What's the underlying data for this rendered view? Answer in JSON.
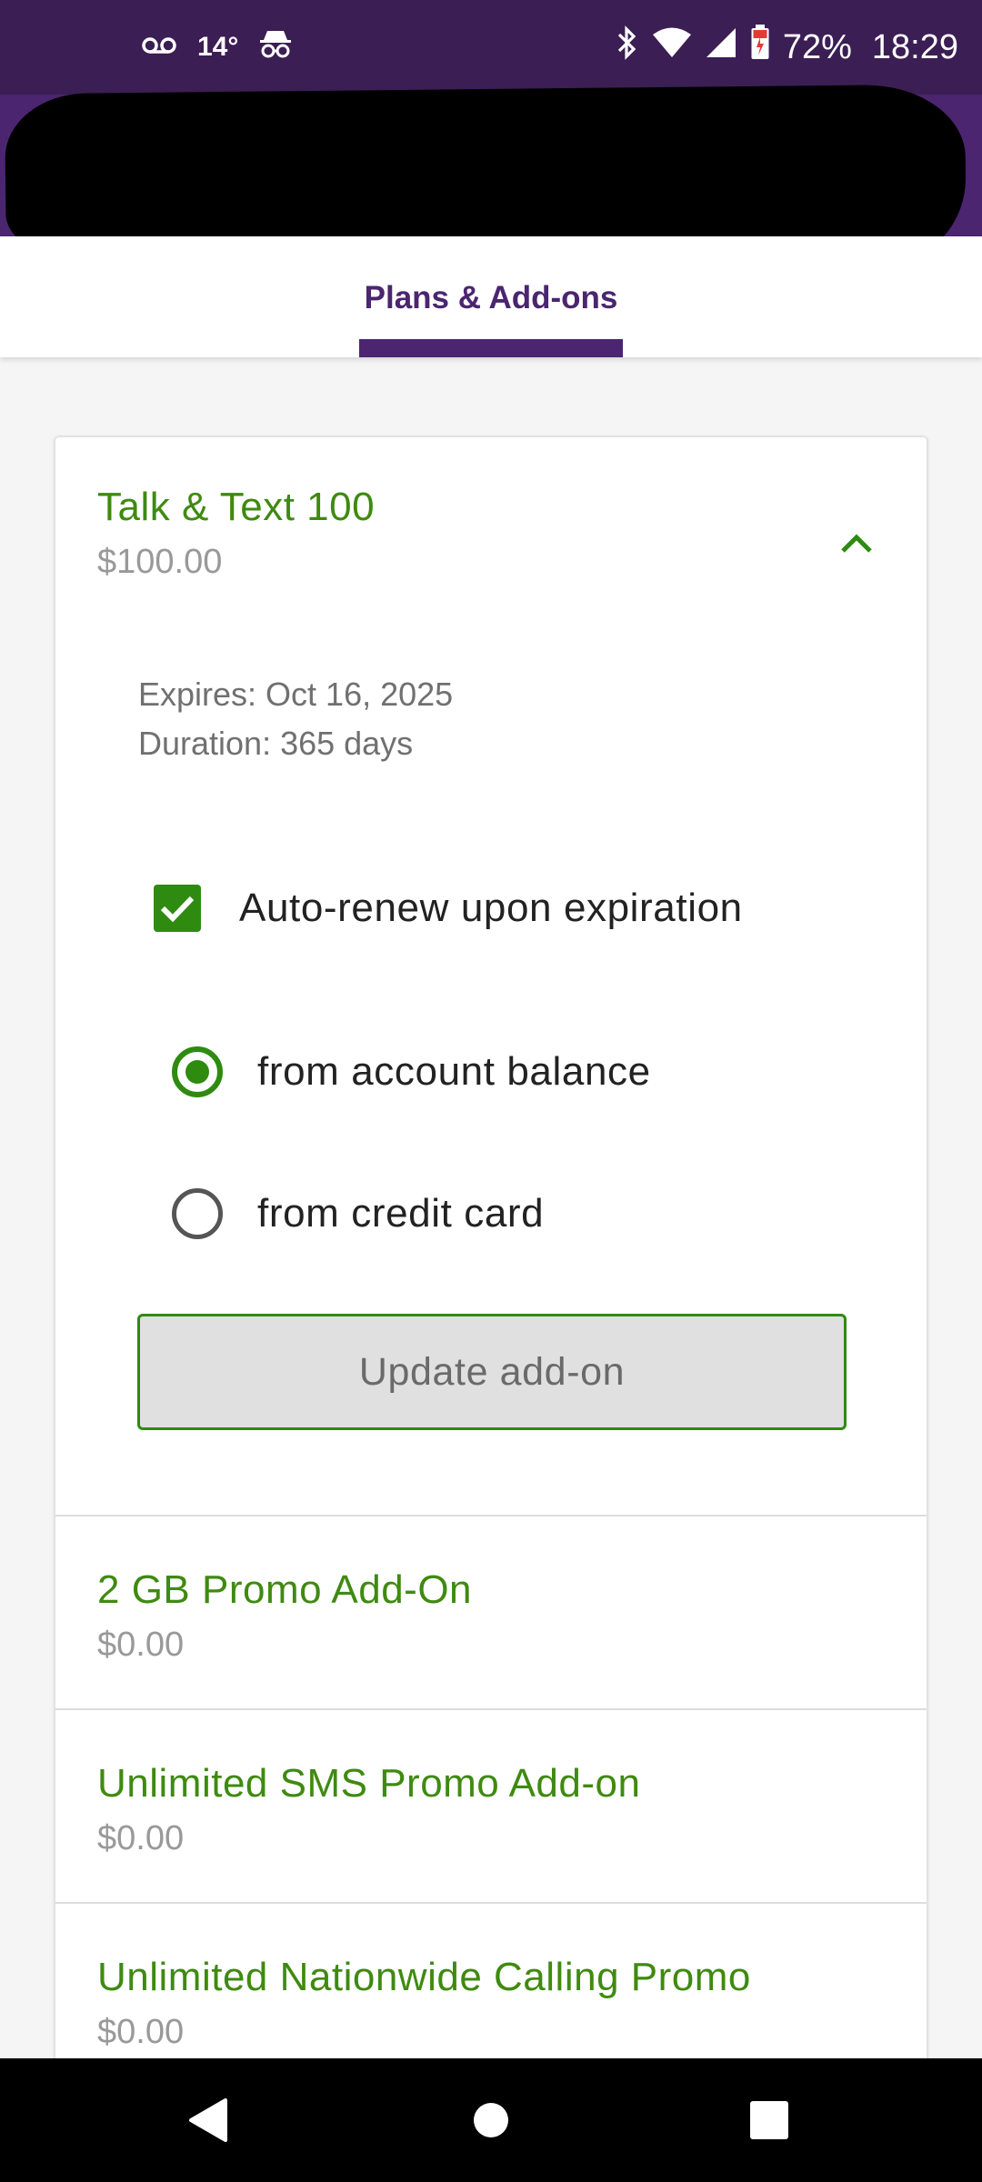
{
  "status_bar": {
    "temperature": "14°",
    "battery": "72%",
    "time": "18:29"
  },
  "tabs": [
    {
      "label": "Plans & Add-ons",
      "selected": true
    }
  ],
  "plans": [
    {
      "title": "Talk & Text 100",
      "price": "$100.00",
      "expires": "Expires: Oct 16, 2025",
      "duration": "Duration: 365 days",
      "auto_renew_label": "Auto-renew upon expiration",
      "auto_renew": true,
      "payment_options": [
        {
          "label": "from account balance",
          "selected": true
        },
        {
          "label": "from credit card",
          "selected": false
        }
      ],
      "update_button": "Update add-on"
    },
    {
      "title": "2 GB Promo Add-On",
      "price": "$0.00"
    },
    {
      "title": "Unlimited SMS Promo Add-on",
      "price": "$0.00"
    },
    {
      "title": "Unlimited Nationwide Calling Promo",
      "price": "$0.00"
    }
  ],
  "colors": {
    "brand_purple": "#4b2570",
    "status_bar": "#3b1e54",
    "accent_green": "#2e8b10"
  }
}
